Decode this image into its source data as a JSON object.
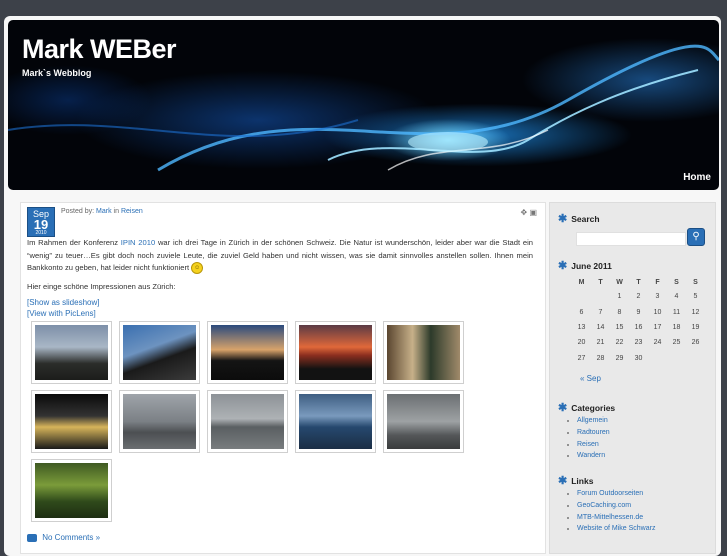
{
  "header": {
    "title": "Mark WEBer",
    "description": "Mark`s Webblog",
    "nav": [
      "Home"
    ]
  },
  "post": {
    "date": {
      "month": "Sep",
      "day": "19",
      "year": "2010"
    },
    "posted_by_prefix": "Posted by:",
    "author": "Mark",
    "in_word": "in",
    "category": "Reisen",
    "paragraph1_a": "Im Rahmen der Konferenz",
    "paragraph1_link": "IPIN 2010",
    "paragraph1_b": "war ich drei Tage in Zürich in der schönen Schweiz. Die Natur ist wunderschön, leider aber war die Stadt ein “wenig” zu teuer…Es gibt doch noch zuviele Leute, die zuviel Geld haben und nicht wissen, was sie damit sinnvolles anstellen sollen. Ihnen mein Bankkonto zu geben, hat leider nicht funktioniert",
    "paragraph2": "Hier einge schöne Impressionen aus Zürich:",
    "slideshow_link": "[Show as slideshow]",
    "piclens_link": "[View with PicLens]",
    "comments": "No Comments »"
  },
  "sidebar": {
    "search_title": "Search",
    "calendar": {
      "title": "June 2011",
      "days": [
        "M",
        "T",
        "W",
        "T",
        "F",
        "S",
        "S"
      ],
      "weeks": [
        [
          "",
          "",
          "1",
          "2",
          "3",
          "4",
          "5"
        ],
        [
          "6",
          "7",
          "8",
          "9",
          "10",
          "11",
          "12"
        ],
        [
          "13",
          "14",
          "15",
          "16",
          "17",
          "18",
          "19"
        ],
        [
          "20",
          "21",
          "22",
          "23",
          "24",
          "25",
          "26"
        ],
        [
          "27",
          "28",
          "29",
          "30",
          "",
          "",
          ""
        ]
      ],
      "prev": "« Sep"
    },
    "categories_title": "Categories",
    "categories": [
      "Allgemein",
      "Radtouren",
      "Reisen",
      "Wandern"
    ],
    "links_title": "Links",
    "links": [
      "Forum Outdoorseiten",
      "GeoCaching.com",
      "MTB-Mittelhessen.de",
      "Website of Mike Schwarz"
    ]
  },
  "colors": {
    "accent": "#2a6fb6",
    "background": "#3d4149"
  }
}
